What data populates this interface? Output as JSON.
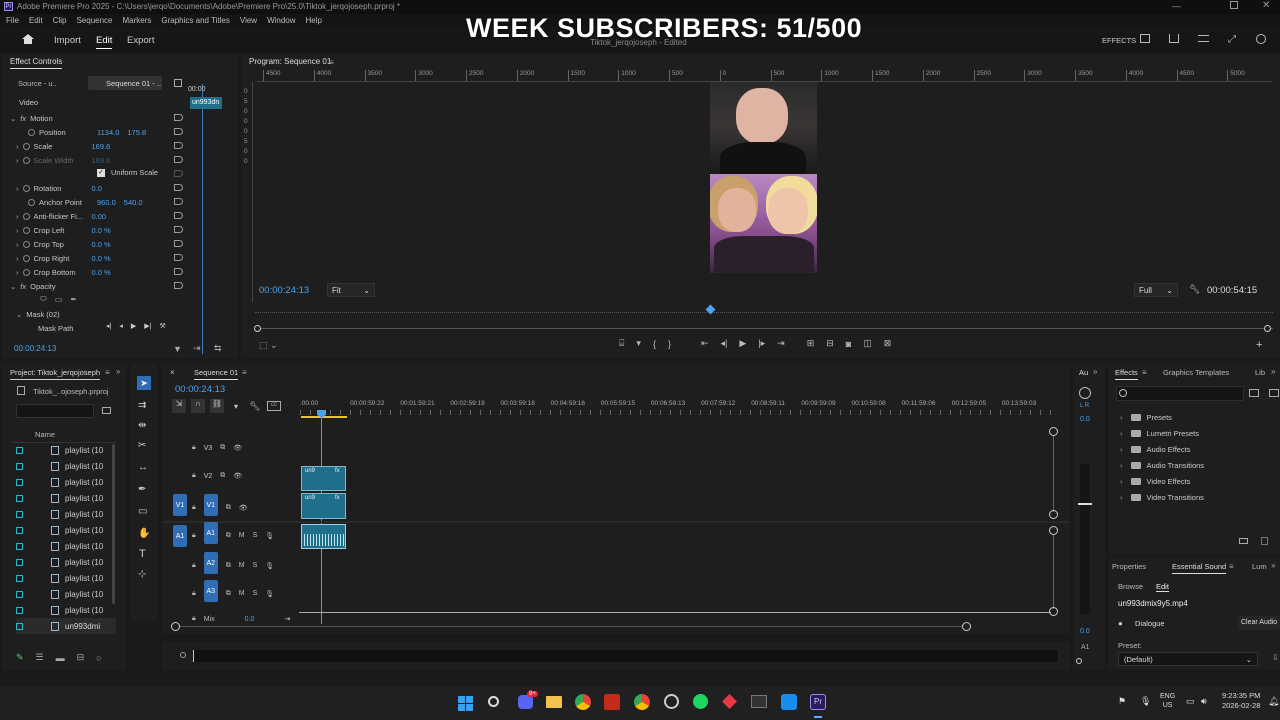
{
  "titlebar": {
    "title": "Adobe Premiere Pro 2025 - C:\\Users\\jerqo\\Documents\\Adobe\\Premiere Pro\\25.0\\Tiktok_jerqojoseph.prproj *"
  },
  "menu": [
    "File",
    "Edit",
    "Clip",
    "Sequence",
    "Markers",
    "Graphics and Titles",
    "View",
    "Window",
    "Help"
  ],
  "header": {
    "import": "Import",
    "edit": "Edit",
    "export": "Export",
    "project_name": "Tiktok_jerqojoseph",
    "project_status": "- Edited",
    "effects": "EFFECTS"
  },
  "overlay": {
    "banner": "WEEK SUBSCRIBERS: 51/500"
  },
  "effect_controls": {
    "tab": "Effect Controls",
    "source": "Source - u..",
    "sequence": "Sequence 01 - ..",
    "clip": "un993dn",
    "video": "Video",
    "motion": "Motion",
    "position": {
      "label": "Position",
      "x": "1134.0",
      "y": "175.8"
    },
    "scale": {
      "label": "Scale",
      "v": "169.6"
    },
    "scale_width": {
      "label": "Scale Width",
      "v": "169.6"
    },
    "uniform": "Uniform Scale",
    "rotation": {
      "label": "Rotation",
      "v": "0.0"
    },
    "anchor": {
      "label": "Anchor Point",
      "x": "960.0",
      "y": "540.0"
    },
    "antiflicker": {
      "label": "Anti-flicker Fi...",
      "v": "0.00"
    },
    "crop_left": {
      "label": "Crop Left",
      "v": "0.0 %"
    },
    "crop_top": {
      "label": "Crop Top",
      "v": "0.0 %"
    },
    "crop_right": {
      "label": "Crop Right",
      "v": "0.0 %"
    },
    "crop_bottom": {
      "label": "Crop Bottom",
      "v": "0.0 %"
    },
    "opacity": "Opacity",
    "mask": "Mask (02)",
    "mask_path": "Mask Path",
    "timecode": "00:00:24:13",
    "mini_tc": "00:00"
  },
  "program": {
    "title": "Program: Sequence 01",
    "ruler": [
      "4500",
      "4000",
      "3500",
      "3000",
      "2500",
      "2000",
      "1500",
      "1000",
      "500",
      "0",
      "500",
      "1000",
      "1500",
      "2000",
      "2500",
      "3000",
      "3500",
      "4000",
      "4500",
      "5000"
    ],
    "vruler": [
      "0",
      "5",
      "0",
      "0",
      "0",
      "5",
      "0",
      "0"
    ],
    "timecode": "00:00:24:13",
    "fit": "Fit",
    "full": "Full",
    "duration": "00:00:54:15"
  },
  "project": {
    "title": "Project: Tiktok_jerqojoseph",
    "file": "Tiktok_..ojoseph.prproj",
    "col_name": "Name",
    "items": [
      "playlist (10",
      "playlist (10",
      "playlist (10",
      "playlist (10",
      "playlist (10",
      "playlist (10",
      "playlist (10",
      "playlist (10",
      "playlist (10",
      "playlist (10",
      "playlist (10",
      "un993dmi"
    ]
  },
  "timeline": {
    "title": "Sequence 01",
    "timecode": "00:00:24:13",
    "ruler": [
      ":00:00",
      "00:00:59:22",
      "00:01:59:21",
      "00:02:59:19",
      "00:03:59:18",
      "00:04:59:16",
      "00:05:59:15",
      "00:06:59:13",
      "00:07:59:12",
      "00:08:59:11",
      "00:09:59:09",
      "00:10:59:08",
      "00:11:59:06",
      "00:12:59:05",
      "00:13:59:03"
    ],
    "tracks": {
      "v3": "V3",
      "v2": "V2",
      "v1": "V1",
      "a1": "A1",
      "a2": "A2",
      "a3": "A3",
      "mix": "Mix",
      "mix_val": "0.0",
      "m": "M",
      "s": "S"
    },
    "clip_label": "un9",
    "fx": "fx"
  },
  "audio_meter": {
    "tab": "Au",
    "top": "0.0",
    "bottom": "0.0",
    "lr": "L R",
    "a1": "A1"
  },
  "effects": {
    "tab": "Effects",
    "tab2": "Graphics Templates",
    "tab3": "Lib",
    "items": [
      "Presets",
      "Lumetri Presets",
      "Audio Effects",
      "Audio Transitions",
      "Video Effects",
      "Video Transitions"
    ]
  },
  "essential": {
    "tab1": "Properties",
    "tab2": "Essential Sound",
    "tab3": "Lum",
    "browse": "Browse",
    "edit": "Edit",
    "file": "un993dmix9y5.mp4",
    "dialogue": "Dialogue",
    "clear": "Clear Audio",
    "preset_label": "Preset:",
    "preset": "(Default)"
  },
  "taskbar": {
    "lang": "ENG",
    "region": "US",
    "time": "9:23:35 PM",
    "date": "2026-02-28",
    "badge": "9+"
  },
  "colors": {
    "accent": "#2f6db5",
    "clip": "#1f6e8a",
    "playhead": "#4aa3f0",
    "bg": "#1a1a1a"
  }
}
